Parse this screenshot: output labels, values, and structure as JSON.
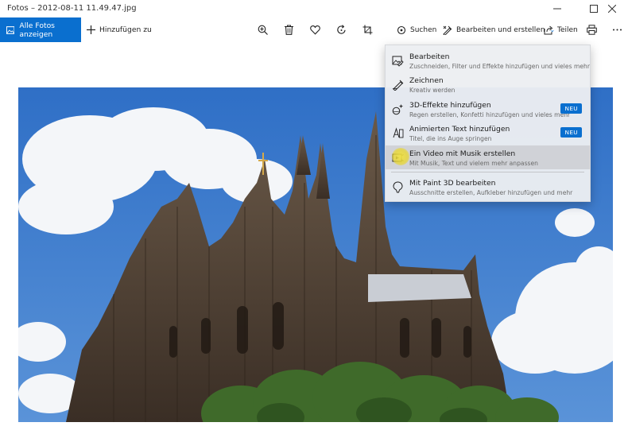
{
  "window": {
    "title": "Fotos – 2012-08-11 11.49.47.jpg"
  },
  "toolbar": {
    "all_photos_label": "Alle Fotos anzeigen",
    "add_label": "Hinzufügen zu",
    "search_label": "Suchen",
    "edit_create_label": "Bearbeiten und erstellen",
    "share_label": "Teilen"
  },
  "menu": {
    "items": [
      {
        "title": "Bearbeiten",
        "subtitle": "Zuschneiden, Filter und Effekte hinzufügen und vieles mehr",
        "icon": "image-edit-icon",
        "badge": ""
      },
      {
        "title": "Zeichnen",
        "subtitle": "Kreativ werden",
        "icon": "pen-icon",
        "badge": ""
      },
      {
        "title": "3D-Effekte hinzufügen",
        "subtitle": "Regen erstellen, Konfetti hinzufügen und vieles mehr",
        "icon": "3d-effects-icon",
        "badge": "NEU"
      },
      {
        "title": "Animierten Text hinzufügen",
        "subtitle": "Titel, die ins Auge springen",
        "icon": "animated-text-icon",
        "badge": "NEU"
      },
      {
        "title": "Ein Video mit Musik erstellen",
        "subtitle": "Mit Musik, Text und vielem mehr anpassen",
        "icon": "video-icon",
        "badge": ""
      },
      {
        "title": "Mit Paint 3D bearbeiten",
        "subtitle": "Ausschnitte erstellen, Aufkleber hinzufügen und mehr",
        "icon": "paint3d-icon",
        "badge": ""
      }
    ]
  },
  "colors": {
    "accent": "#0a6fcf",
    "sky": "#3f7fd0",
    "cursor_highlight": "#f0e246"
  }
}
